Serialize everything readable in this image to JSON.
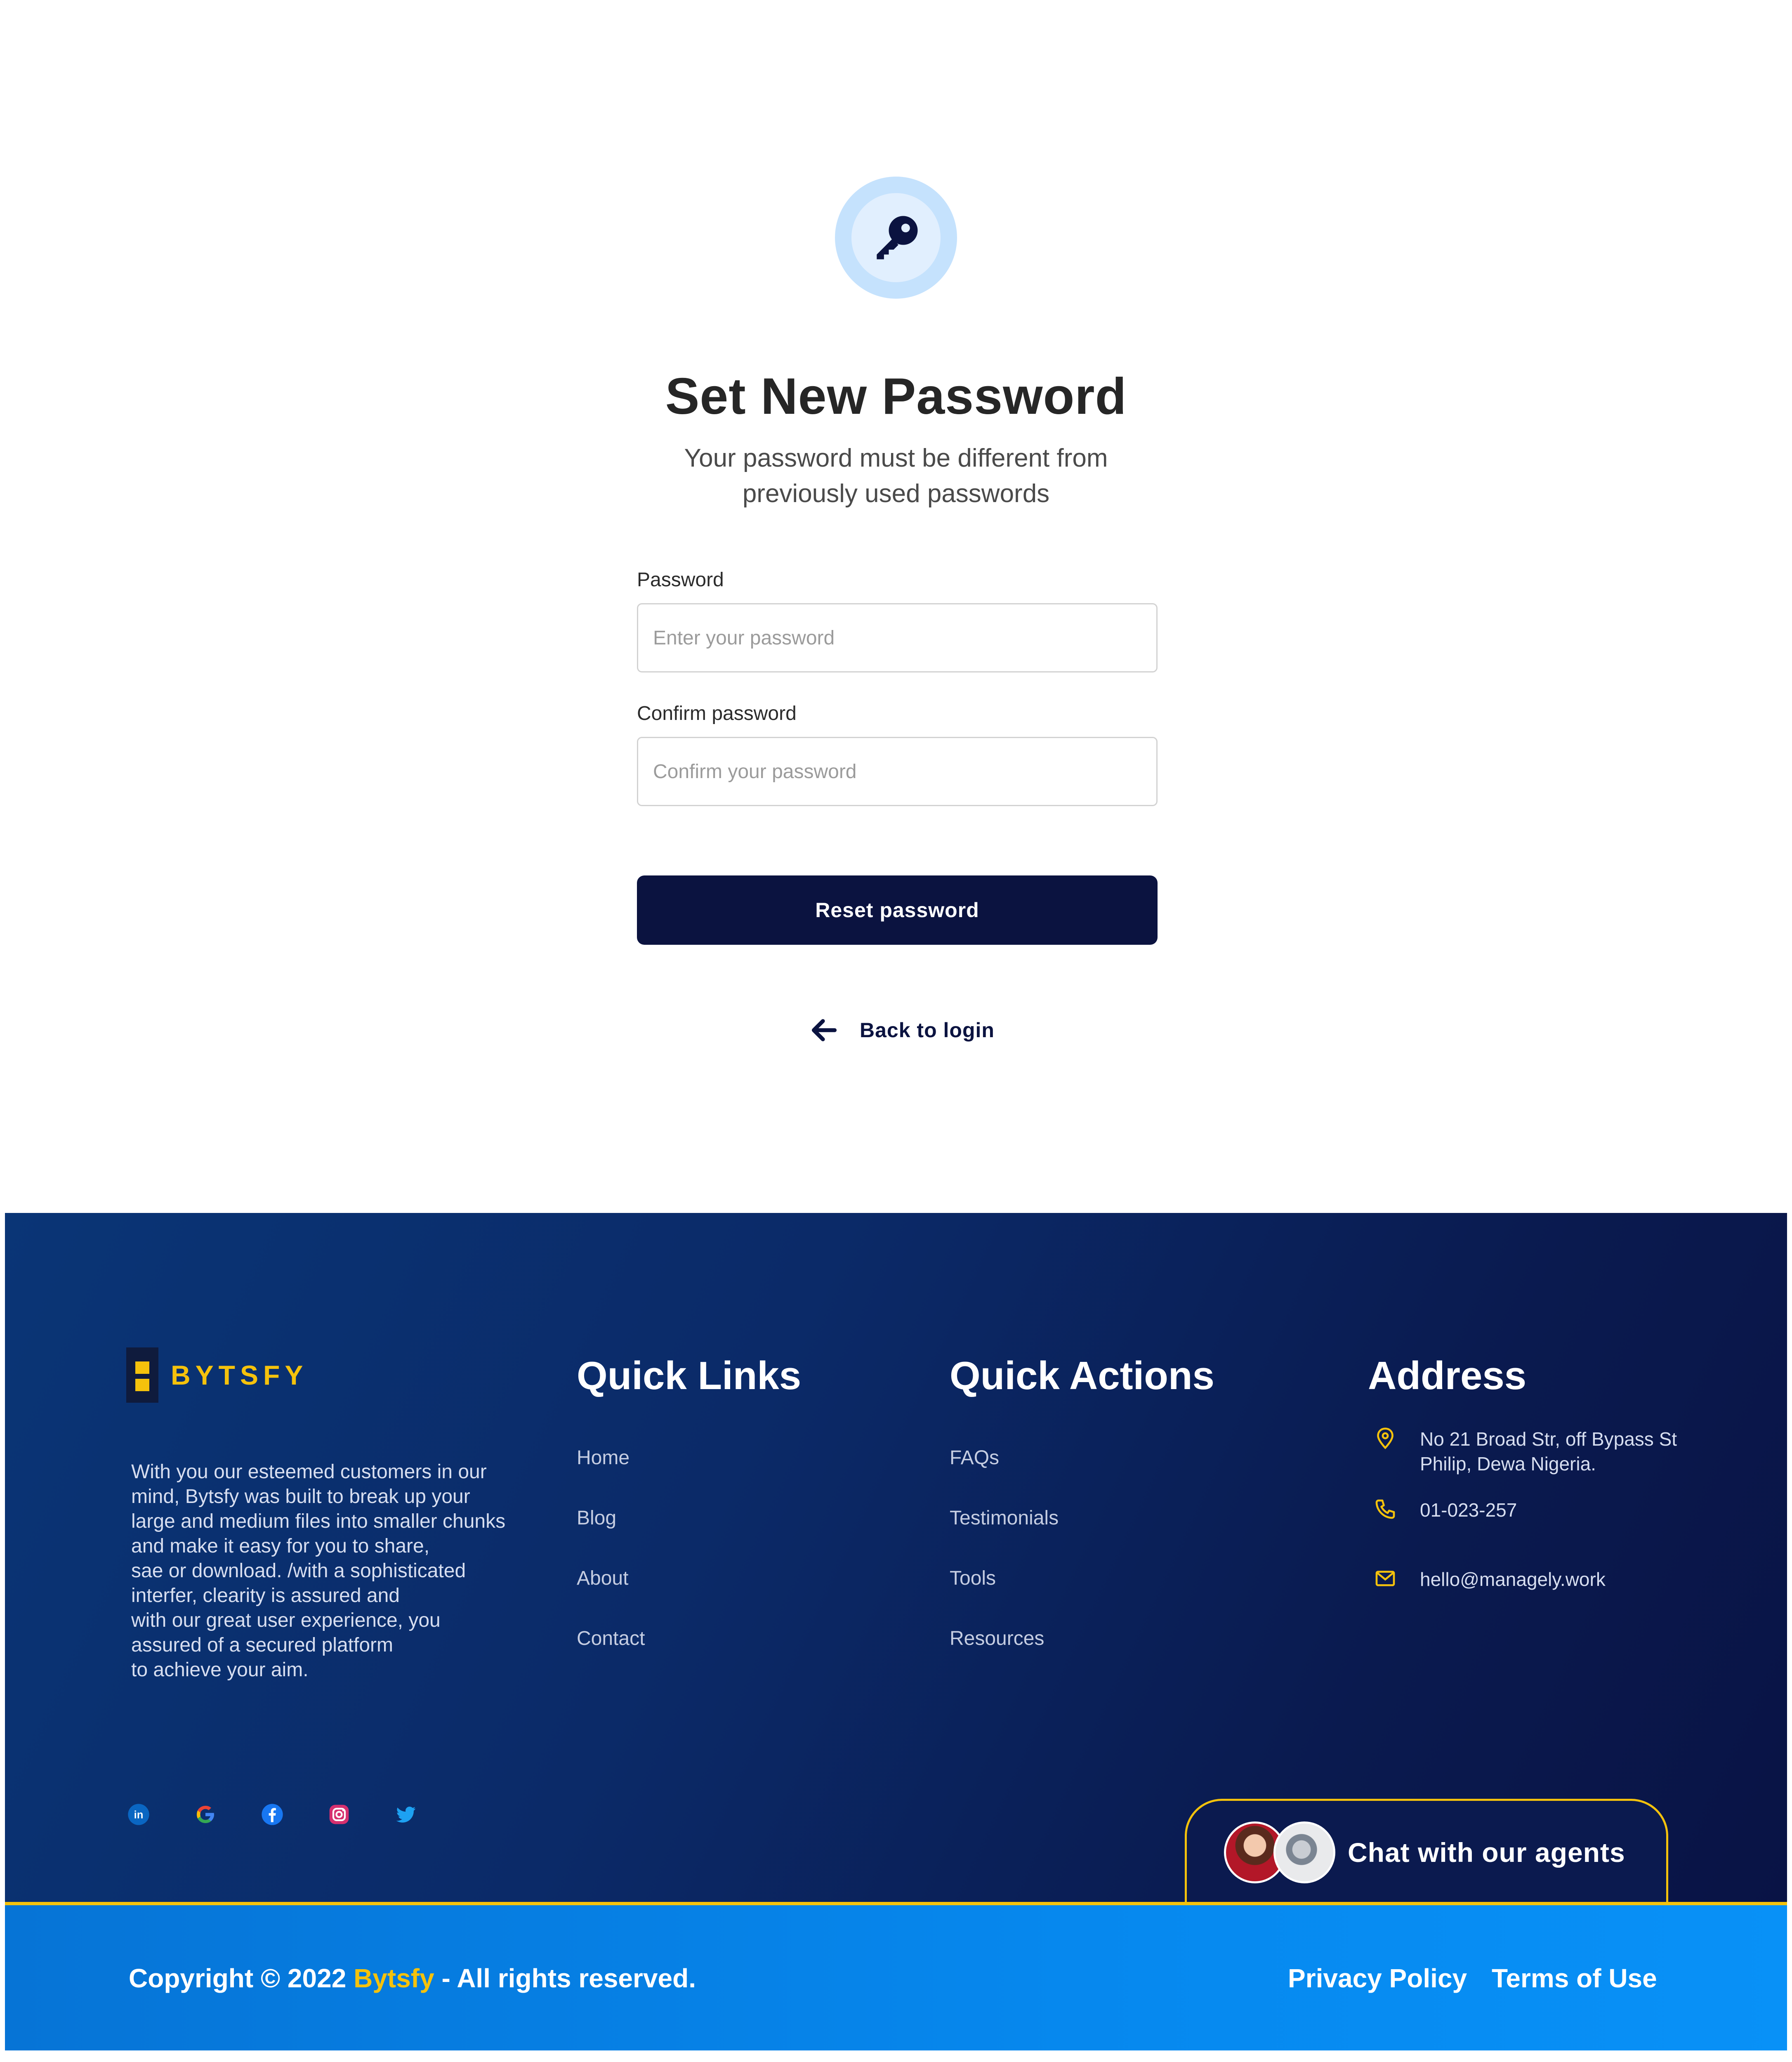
{
  "form": {
    "title": "Set New Password",
    "subtitle_line1": "Your password must be different from",
    "subtitle_line2": "previously used passwords",
    "password_label": "Password",
    "password_placeholder": "Enter your password",
    "confirm_label": "Confirm password",
    "confirm_placeholder": "Confirm your password",
    "reset_button": "Reset password",
    "back_link": "Back to login",
    "key_icon": "key-icon",
    "back_icon": "arrow-left-icon"
  },
  "footer": {
    "brand": "BYTSFY",
    "about": "With you our esteemed customers in our\nmind, Bytsfy was built to break up your\nlarge and medium files into smaller chunks\nand make it easy for you to share,\nsae or download. /with a sophisticated\ninterfer, clearity is assured and\nwith our great user experience, you\nassured of a secured platform\nto achieve your aim.",
    "quick_links": {
      "title": "Quick Links",
      "items": [
        "Home",
        "Blog",
        "About",
        "Contact"
      ]
    },
    "quick_actions": {
      "title": "Quick Actions",
      "items": [
        "FAQs",
        "Testimonials",
        "Tools",
        "Resources"
      ]
    },
    "address": {
      "title": "Address",
      "location": "No 21 Broad Str, off Bypass St\nPhilip, Dewa Nigeria.",
      "phone": "01-023-257",
      "email": "hello@managely.work"
    },
    "social_icons": [
      "linkedin-icon",
      "google-icon",
      "facebook-icon",
      "instagram-icon",
      "twitter-icon"
    ],
    "chat_label": "Chat with our agents"
  },
  "bottom": {
    "copyright_prefix": "Copyright © 2022 ",
    "copyright_brand": "Bytsfy",
    "copyright_suffix": " - All rights reserved.",
    "privacy": "Privacy Policy",
    "terms": "Terms of Use"
  },
  "colors": {
    "primary_dark": "#0b1340",
    "accent_yellow": "#f5c20c",
    "bottom_blue": "#0688ee"
  }
}
